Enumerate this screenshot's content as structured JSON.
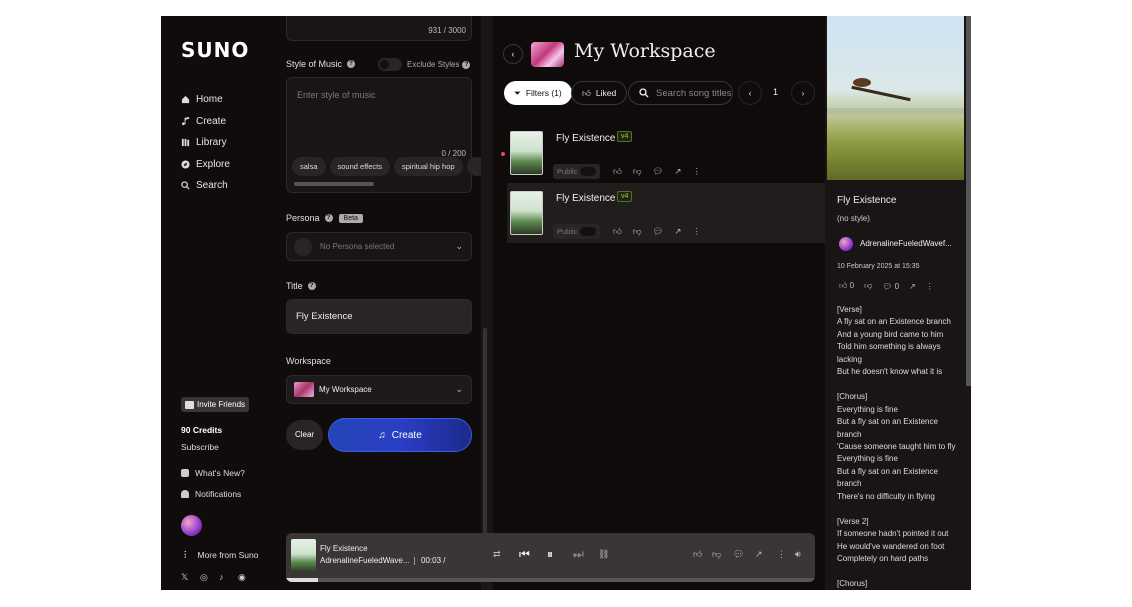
{
  "sidebar": {
    "logo": "SUNO",
    "nav": [
      {
        "label": "Home",
        "icon": "home-icon"
      },
      {
        "label": "Create",
        "icon": "music-note-icon"
      },
      {
        "label": "Library",
        "icon": "library-icon"
      },
      {
        "label": "Explore",
        "icon": "compass-icon"
      },
      {
        "label": "Search",
        "icon": "search-icon"
      }
    ],
    "invite": "Invite Friends",
    "credits": "90 Credits",
    "subscribe": "Subscribe",
    "whats_new": "What's New?",
    "notifications": "Notifications",
    "more": "More from Suno"
  },
  "create": {
    "lyrics_count": "931 / 3000",
    "style_label": "Style of Music",
    "exclude_label": "Exclude Styles",
    "style_placeholder": "Enter style of music",
    "style_count": "0 / 200",
    "tags": [
      "salsa",
      "sound effects",
      "spiritual hip hop"
    ],
    "persona_label": "Persona",
    "persona_badge": "Beta",
    "persona_value": "No Persona selected",
    "title_label": "Title",
    "title_value": "Fly Existence",
    "workspace_label": "Workspace",
    "workspace_value": "My Workspace",
    "clear_label": "Clear",
    "create_label": "Create"
  },
  "workspace": {
    "title": "My Workspace",
    "filters_label": "Filters (1)",
    "liked_label": "Liked",
    "search_placeholder": "Search song titles",
    "page": "1",
    "songs": [
      {
        "title": "Fly Existence",
        "version": "v4",
        "visibility": "Public"
      },
      {
        "title": "Fly Existence",
        "version": "v4",
        "visibility": "Public"
      }
    ]
  },
  "detail": {
    "title": "Fly Existence",
    "style": "(no style)",
    "user": "AdrenalineFueledWavef...",
    "date": "10 February 2025 at 15:35",
    "likes": "0",
    "comments": "0",
    "lyrics": "[Verse]\nA fly sat on an Existence branch\nAnd a young bird came to him\nTold him something is always lacking\nBut he doesn't know what it is\n\n[Chorus]\nEverything is fine\nBut a fly sat on an Existence branch\n'Cause someone taught him to fly\nEverything is fine\nBut a fly sat on an Existence branch\nThere's no difficulty in flying\n\n[Verse 2]\nIf someone hadn't pointed it out\nHe would've wandered on foot\nCompletely on hard paths\n\n[Chorus]"
  },
  "player": {
    "title": "Fly Existence",
    "user": "AdrenalineFueledWave...",
    "time": "00:03 /",
    "progress": 0.06
  }
}
